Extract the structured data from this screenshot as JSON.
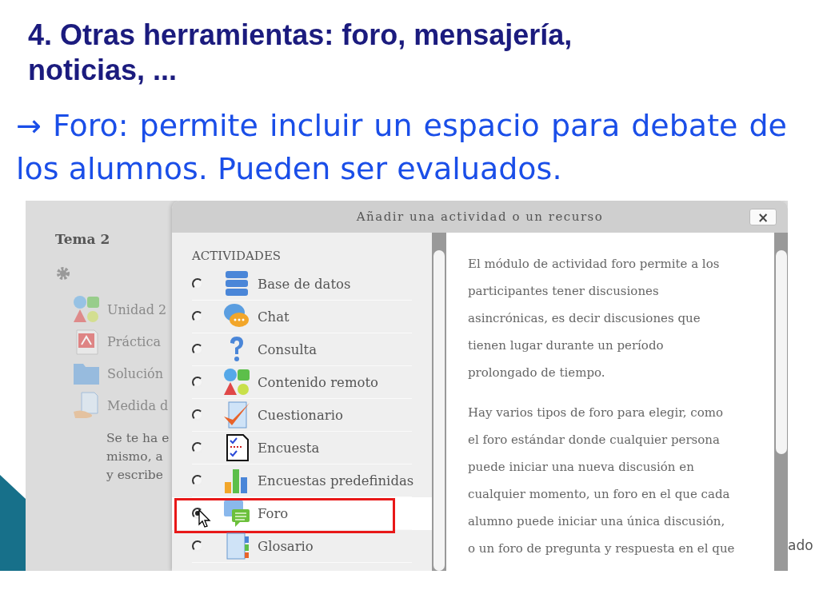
{
  "slide": {
    "title": "4. Otras herramientas: foro, mensajería, noticias, ...",
    "body": "→ Foro: permite incluir un espacio para debate de los alumnos. Pueden ser evaluados.",
    "footer_fragment": "ado"
  },
  "course_page": {
    "section_title": "Tema 2",
    "items": [
      {
        "label": "Unidad 2"
      },
      {
        "label": "Práctica"
      },
      {
        "label": "Solución"
      },
      {
        "label": "Medida d"
      }
    ],
    "note_lines": [
      "Se te ha e",
      "mismo, a",
      "y escribe"
    ]
  },
  "dialog": {
    "title": "Añadir una actividad o un recurso",
    "close": "×",
    "section": "ACTIVIDADES",
    "options": [
      {
        "label": "Base de datos",
        "selected": false
      },
      {
        "label": "Chat",
        "selected": false
      },
      {
        "label": "Consulta",
        "selected": false
      },
      {
        "label": "Contenido remoto",
        "selected": false
      },
      {
        "label": "Cuestionario",
        "selected": false
      },
      {
        "label": "Encuesta",
        "selected": false
      },
      {
        "label": "Encuestas predefinidas",
        "selected": false
      },
      {
        "label": "Foro",
        "selected": true
      },
      {
        "label": "Glosario",
        "selected": false
      }
    ],
    "description": [
      [
        "El módulo de actividad foro permite a los",
        "participantes tener discusiones",
        "asincrónicas, es decir discusiones que",
        "tienen lugar durante un período",
        "prolongado de tiempo."
      ],
      [
        "Hay varios tipos de foro para elegir, como",
        "el foro estándar donde cualquier persona",
        "puede iniciar una nueva discusión en",
        "cualquier momento, un foro en el que cada",
        "alumno puede iniciar una única discusión,",
        "o un foro de pregunta y respuesta en el que"
      ]
    ]
  }
}
